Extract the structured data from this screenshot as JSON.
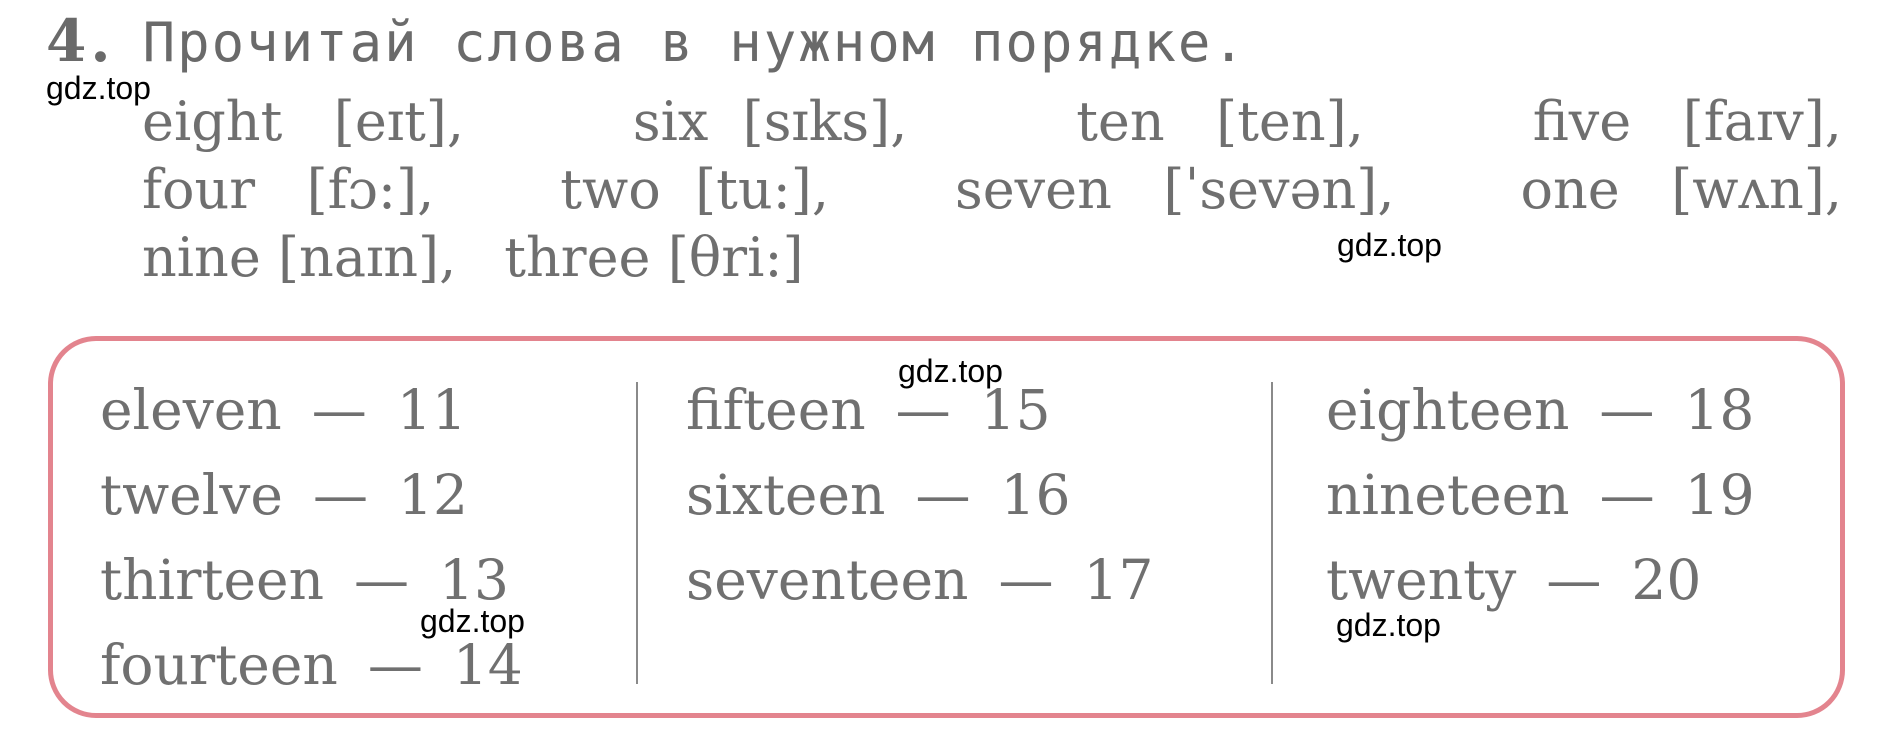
{
  "exercise": {
    "number": "4.",
    "instruction": "Прочитай слова в нужном порядке."
  },
  "words": [
    [
      {
        "word": "eight",
        "transcription": "[eɪt],"
      },
      {
        "word": "six",
        "transcription": "[sɪks],"
      },
      {
        "word": "ten",
        "transcription": "[ten],"
      },
      {
        "word": "five",
        "transcription": "[faɪv],"
      }
    ],
    [
      {
        "word": "four",
        "transcription": "[fɔ:],"
      },
      {
        "word": "two",
        "transcription": "[tu:],"
      },
      {
        "word": "seven",
        "transcription": "[ˈsevən],"
      },
      {
        "word": "one",
        "transcription": "[wʌn],"
      }
    ],
    [
      {
        "word": "nine",
        "transcription": "[naɪn],"
      },
      {
        "word": "three",
        "transcription": "[θri:]"
      }
    ]
  ],
  "numbers_box": {
    "columns": [
      [
        {
          "word": "eleven",
          "dash": "—",
          "number": "11"
        },
        {
          "word": "twelve",
          "dash": "—",
          "number": "12"
        },
        {
          "word": "thirteen",
          "dash": "—",
          "number": "13"
        },
        {
          "word": "fourteen",
          "dash": "—",
          "number": "14"
        }
      ],
      [
        {
          "word": "fifteen",
          "dash": "—",
          "number": "15"
        },
        {
          "word": "sixteen",
          "dash": "—",
          "number": "16"
        },
        {
          "word": "seventeen",
          "dash": "—",
          "number": "17"
        }
      ],
      [
        {
          "word": "eighteen",
          "dash": "—",
          "number": "18"
        },
        {
          "word": "nineteen",
          "dash": "—",
          "number": "19"
        },
        {
          "word": "twenty",
          "dash": "—",
          "number": "20"
        }
      ]
    ],
    "border_color": "#e3848e"
  },
  "watermarks": [
    "gdz.top",
    "gdz.top",
    "gdz.top",
    "gdz.top",
    "gdz.top"
  ]
}
